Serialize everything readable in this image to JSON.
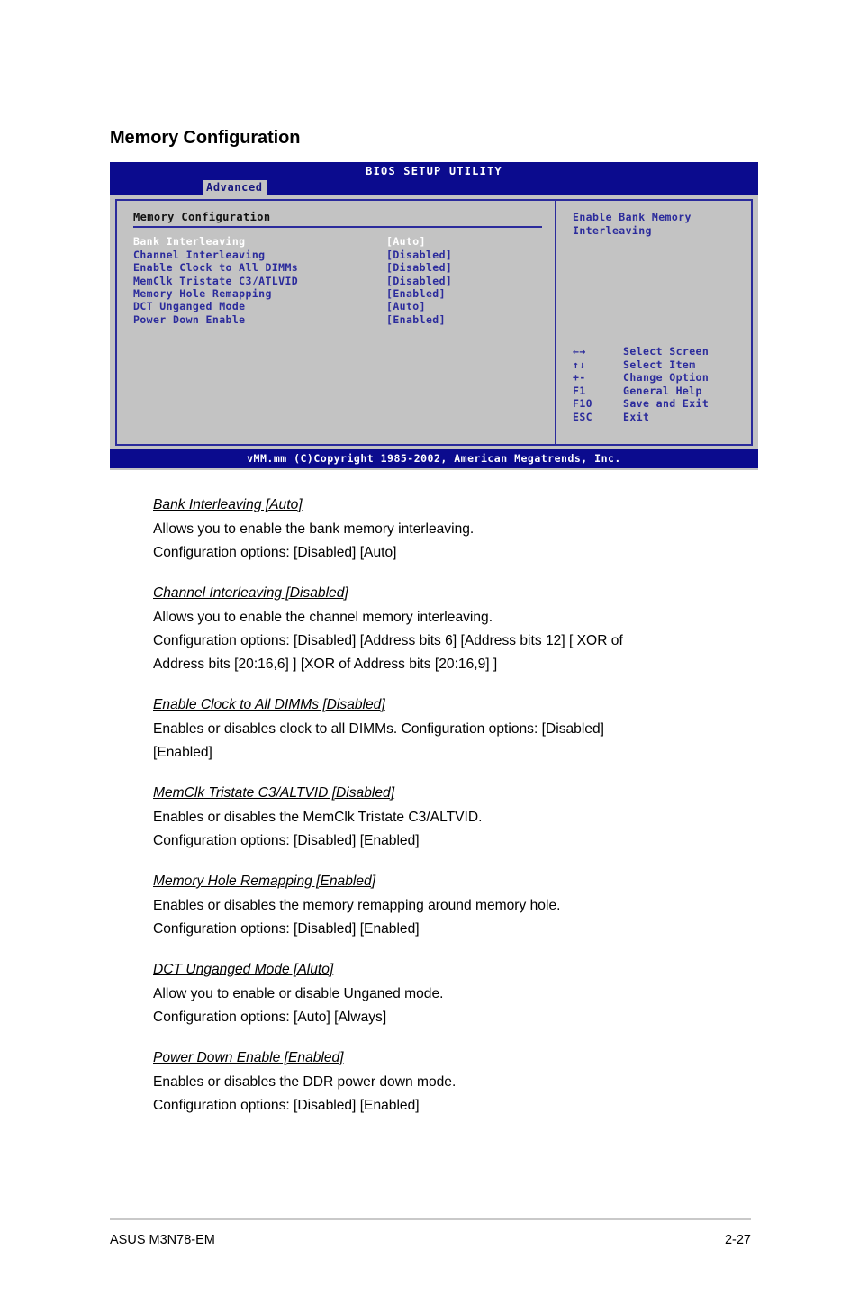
{
  "page_title": "Memory Configuration",
  "bios": {
    "title": "BIOS SETUP UTILITY",
    "active_tab": "Advanced",
    "section_header": "Memory Configuration",
    "options": [
      {
        "label": "Bank Interleaving",
        "value": "[Auto]",
        "selected": true
      },
      {
        "label": "Channel Interleaving",
        "value": "[Disabled]",
        "selected": false
      },
      {
        "label": "Enable Clock to All DIMMs",
        "value": "[Disabled]",
        "selected": false
      },
      {
        "label": "MemClk Tristate C3/ATLVID",
        "value": "[Disabled]",
        "selected": false
      },
      {
        "label": "Memory Hole Remapping",
        "value": "[Enabled]",
        "selected": false
      },
      {
        "label": "DCT Unganged Mode",
        "value": "[Auto]",
        "selected": false
      },
      {
        "label": "Power Down Enable",
        "value": "[Enabled]",
        "selected": false
      }
    ],
    "help_line1": "Enable Bank Memory",
    "help_line2": "Interleaving",
    "keys": [
      {
        "glyph": "←→",
        "desc": "Select Screen"
      },
      {
        "glyph": "↑↓",
        "desc": "Select Item"
      },
      {
        "glyph": "+-",
        "desc": "Change Option"
      },
      {
        "glyph": "F1",
        "desc": "General Help"
      },
      {
        "glyph": "F10",
        "desc": "Save and Exit"
      },
      {
        "glyph": "ESC",
        "desc": "Exit"
      }
    ],
    "footer": "vMM.mm (C)Copyright 1985-2002, American Megatrends, Inc.",
    "colors": {
      "bar_blue": "#0b0b8e",
      "text_blue": "#2b2b9c",
      "panel_gray": "#c3c3c3",
      "selected_text": "#ffffff"
    }
  },
  "entries": [
    {
      "title": "Bank Interleaving [Auto]",
      "lines": [
        "Allows you to enable the bank memory interleaving.",
        "Configuration options: [Disabled] [Auto]"
      ]
    },
    {
      "title": "Channel Interleaving [Disabled]",
      "lines": [
        "Allows you to enable the channel memory interleaving.",
        "Configuration options: [Disabled] [Address bits 6] [Address bits 12] [ XOR of",
        "Address bits [20:16,6] ] [XOR of Address bits [20:16,9] ]"
      ]
    },
    {
      "title": "Enable Clock to All DIMMs [Disabled]",
      "lines": [
        "Enables or disables clock to all DIMMs. Configuration options: [Disabled]",
        "[Enabled]"
      ]
    },
    {
      "title": "MemClk Tristate C3/ALTVID [Disabled]",
      "lines": [
        "Enables or disables the MemClk Tristate C3/ALTVID.",
        "Configuration options: [Disabled] [Enabled]"
      ]
    },
    {
      "title": "Memory Hole Remapping [Enabled]",
      "lines": [
        "Enables or disables the memory remapping around memory hole.",
        "Configuration options: [Disabled] [Enabled]"
      ]
    },
    {
      "title": "DCT Unganged Mode [Aluto]",
      "lines": [
        "Allow you to enable or disable Unganed mode.",
        "Configuration options: [Auto] [Always]"
      ]
    },
    {
      "title": "Power Down Enable [Enabled]",
      "lines": [
        "Enables or disables the DDR power down mode.",
        "Configuration options: [Disabled] [Enabled]"
      ]
    }
  ],
  "footer": {
    "product": "ASUS M3N78-EM",
    "page_number": "2-27"
  }
}
